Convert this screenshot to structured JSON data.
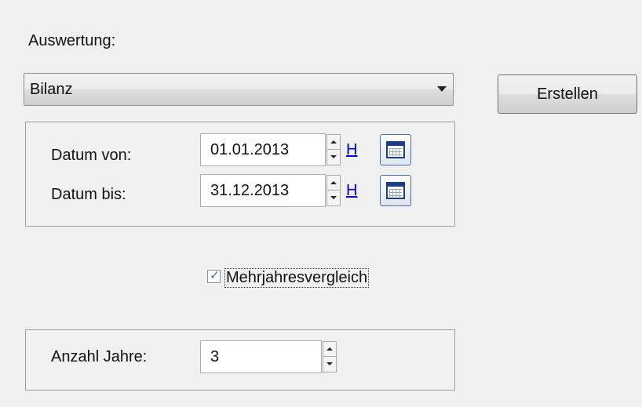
{
  "evaluation_label": "Auswertung:",
  "evaluation_select": {
    "value": "Bilanz"
  },
  "create_button": "Erstellen",
  "date_group": {
    "from_label": "Datum von:",
    "from_value": "01.01.2013",
    "to_label": "Datum bis:",
    "to_value": "31.12.2013",
    "today_link": "H"
  },
  "multi_year": {
    "label": "Mehrjahresvergleich",
    "checked": true
  },
  "years_group": {
    "label": "Anzahl Jahre:",
    "value": "3"
  },
  "icons": [
    "chevron-down-icon",
    "spin-up-icon",
    "spin-down-icon",
    "calendar-icon",
    "checkmark-icon"
  ]
}
